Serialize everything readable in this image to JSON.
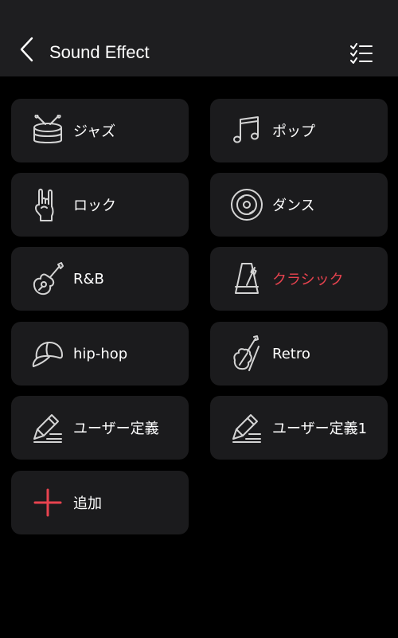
{
  "header": {
    "title": "Sound Effect",
    "back_icon": "chevron-left-icon",
    "list_icon": "checklist-icon"
  },
  "colors": {
    "background": "#000000",
    "header": "#1e1e20",
    "card": "#1b1b1d",
    "icon": "#d4d4d4",
    "accent": "#e8434f"
  },
  "effects": [
    {
      "label": "ジャズ",
      "icon": "drum-icon"
    },
    {
      "label": "ポップ",
      "icon": "music-note-icon"
    },
    {
      "label": "ロック",
      "icon": "rock-hand-icon"
    },
    {
      "label": "ダンス",
      "icon": "vinyl-disc-icon"
    },
    {
      "label": "R&B",
      "icon": "guitar-icon"
    },
    {
      "label": "クラシック",
      "icon": "metronome-icon",
      "selected": true
    },
    {
      "label": "hip-hop",
      "icon": "cap-icon"
    },
    {
      "label": "Retro",
      "icon": "violin-icon"
    },
    {
      "label": "ユーザー定義",
      "icon": "edit-icon"
    },
    {
      "label": "ユーザー定義1",
      "icon": "edit-icon"
    },
    {
      "label": "追加",
      "icon": "add-icon"
    }
  ]
}
